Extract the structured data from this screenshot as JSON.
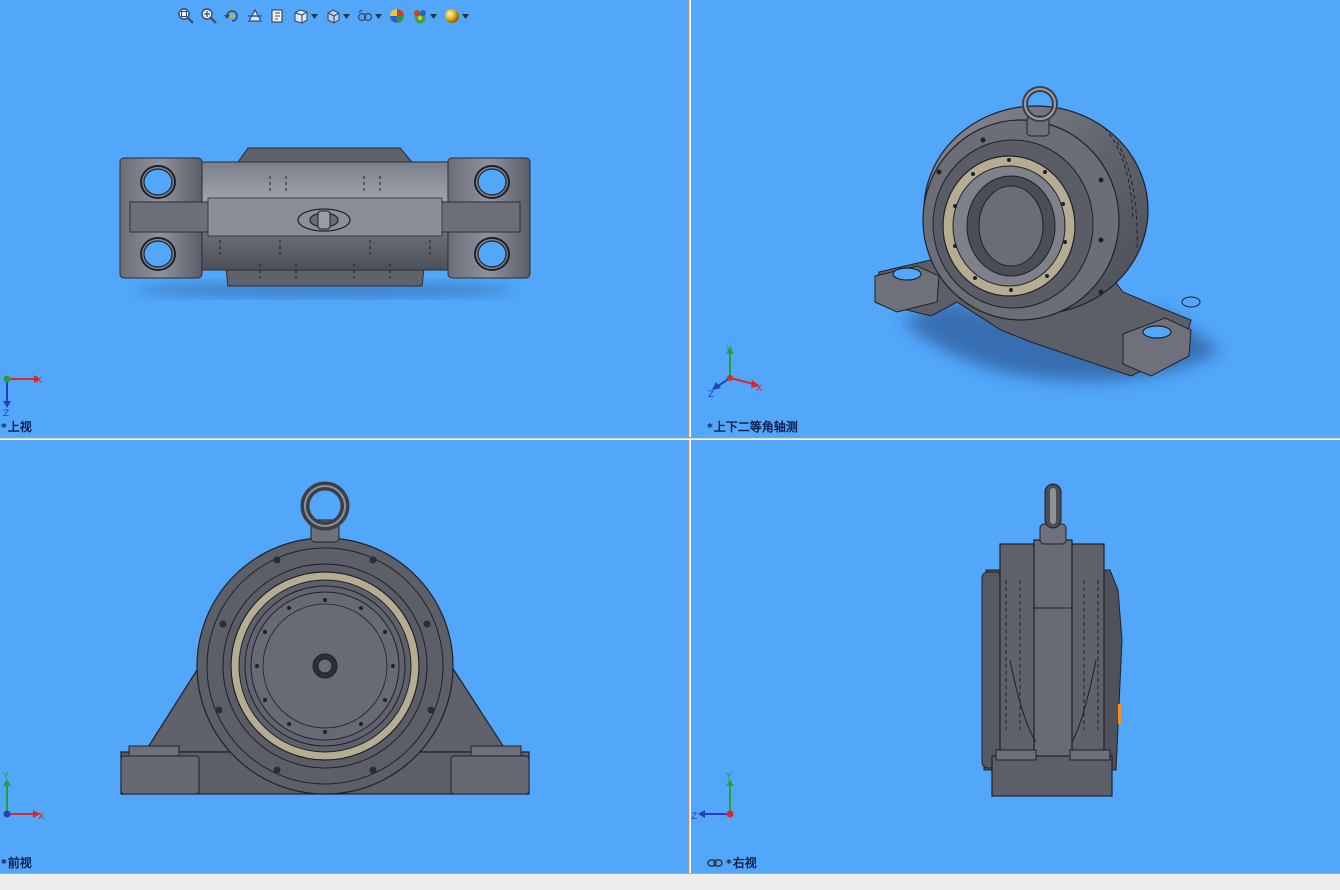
{
  "toolbar": {
    "items": [
      {
        "name": "zoom-to-fit-icon"
      },
      {
        "name": "zoom-to-area-icon"
      },
      {
        "name": "previous-view-icon"
      },
      {
        "name": "section-view-icon"
      },
      {
        "name": "dynamic-annotation-icon"
      },
      {
        "name": "view-orientation-icon",
        "dropdown": true
      },
      {
        "name": "display-style-icon",
        "dropdown": true
      },
      {
        "name": "hide-show-items-icon",
        "dropdown": true
      },
      {
        "name": "edit-appearance-icon"
      },
      {
        "name": "apply-scene-icon",
        "dropdown": true
      },
      {
        "name": "view-settings-icon",
        "dropdown": true
      }
    ]
  },
  "viewports": {
    "top": {
      "star": "*",
      "label": "上视",
      "triad": {
        "x": "X",
        "z": "Z"
      }
    },
    "iso": {
      "star": "*",
      "label": "上下二等角轴测",
      "triad": {
        "x": "X",
        "y": "Y",
        "z": "Z"
      }
    },
    "front": {
      "star": "*",
      "label": "前视",
      "triad": {
        "x": "X",
        "y": "Y"
      }
    },
    "right": {
      "star": "*",
      "label": "右视",
      "triad": {
        "y": "Y",
        "z": "Z"
      }
    }
  },
  "colors": {
    "viewport_background": "#52a7fb",
    "model_gray": "#5c5f68",
    "ring_tan": "#b6ac92",
    "axis_x": "#d62a2a",
    "axis_y": "#25a03a",
    "axis_z": "#2a3fb8"
  }
}
